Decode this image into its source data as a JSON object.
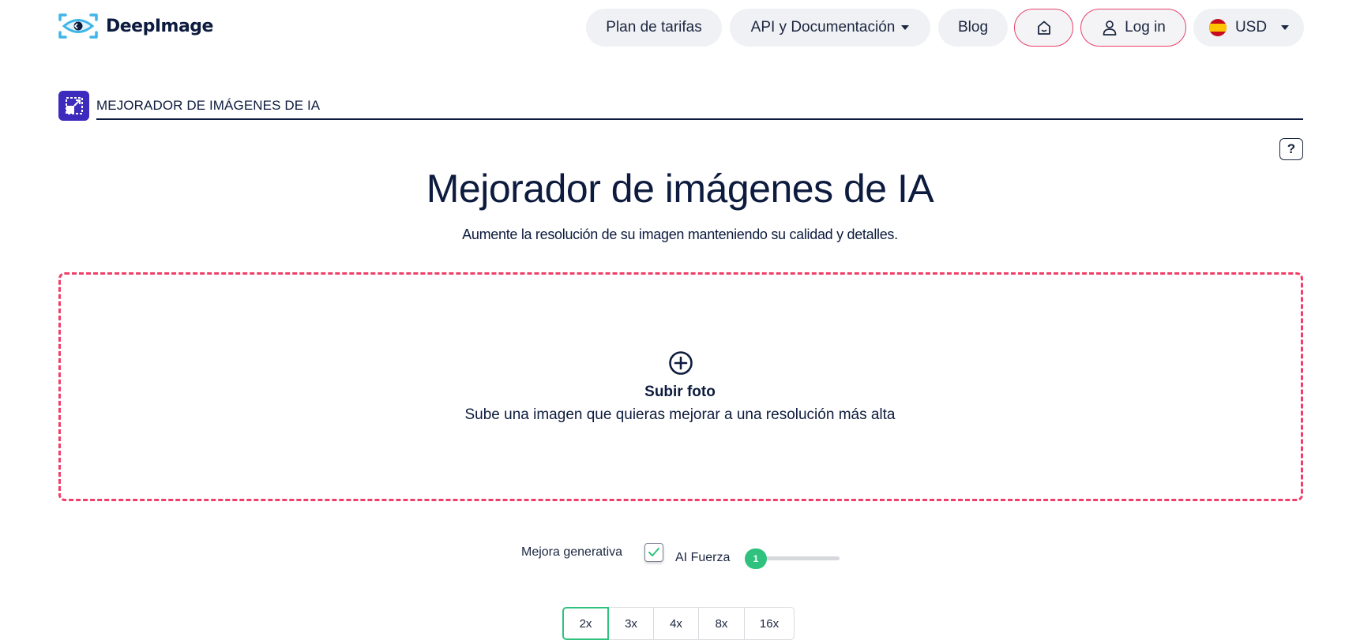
{
  "brand": {
    "name": "DeepImage",
    "accent": "#3fb6e8"
  },
  "nav": {
    "pricing": "Plan de tarifas",
    "api_docs": "API y Documentación",
    "blog": "Blog",
    "login": "Log in",
    "currency": "USD"
  },
  "section": {
    "label": "MEJORADOR DE IMÁGENES DE IA"
  },
  "help": {
    "label": "?"
  },
  "hero": {
    "title": "Mejorador de imágenes de IA",
    "subtitle": "Aumente la resolución de su imagen manteniendo su calidad y detalles."
  },
  "upload": {
    "title": "Subir foto",
    "description": "Sube una imagen que quieras mejorar a una resolución más alta",
    "border_color": "#ef3f68"
  },
  "options": {
    "generative_label": "Mejora generativa",
    "generative_checked": true,
    "ai_strength_label": "AI Fuerza",
    "ai_strength_value": "1"
  },
  "scales": [
    "2x",
    "3x",
    "4x",
    "8x",
    "16x"
  ],
  "selected_scale": "2x",
  "colors": {
    "accent_green": "#2ec27e",
    "accent_pink": "#e8416a",
    "navy": "#0d1b3e"
  }
}
